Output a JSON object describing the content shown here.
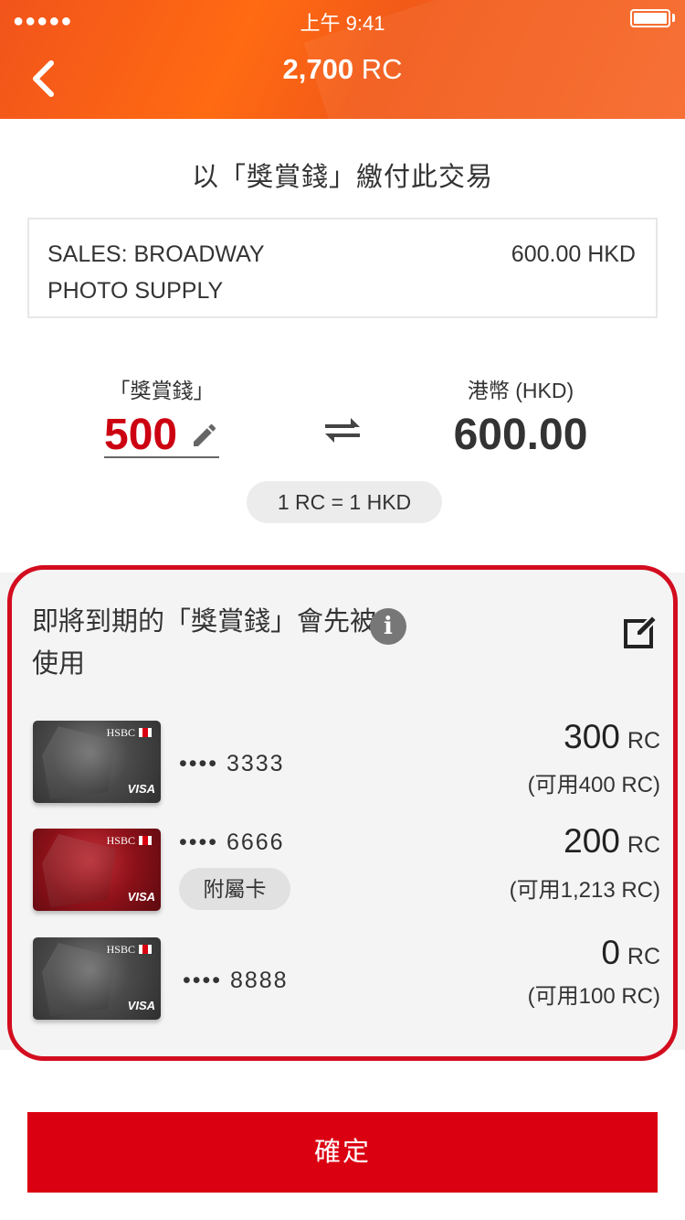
{
  "status_bar": {
    "signal": "●●●●●",
    "time": "上午 9:41"
  },
  "header": {
    "balance_value": "2,700",
    "balance_unit": "RC",
    "back_icon": "chevron-left-icon"
  },
  "subtitle": "以「獎賞錢」繳付此交易",
  "transaction": {
    "merchant": "SALES: BROADWAY PHOTO SUPPLY",
    "amount": "600.00 HKD"
  },
  "conversion": {
    "rc_label": "「獎賞錢」",
    "rc_value": "500",
    "hkd_label": "港幣 (HKD)",
    "hkd_value": "600.00",
    "rate": "1 RC = 1 HKD"
  },
  "cards_panel": {
    "heading": "即將到期的「獎賞錢」會先被使用",
    "info_icon_glyph": "i",
    "cards": [
      {
        "brand": "HSBC",
        "network": "VISA",
        "number": "•••• 3333",
        "rc": "300",
        "unit": "RC",
        "available": "(可用400 RC)",
        "badge": "",
        "color": "grey"
      },
      {
        "brand": "HSBC",
        "network": "VISA",
        "number": "•••• 6666",
        "rc": "200",
        "unit": "RC",
        "available": "(可用1,213 RC)",
        "badge": "附屬卡",
        "color": "red"
      },
      {
        "brand": "HSBC",
        "network": "VISA",
        "number": "•••• 8888",
        "rc": "0",
        "unit": "RC",
        "available": "(可用100 RC)",
        "badge": "",
        "color": "grey"
      }
    ]
  },
  "confirm_label": "確定",
  "colors": {
    "header": "#f2541b",
    "accent_red": "#db0011",
    "rc_value": "#cc0011",
    "panel_border": "#d30d1f"
  }
}
